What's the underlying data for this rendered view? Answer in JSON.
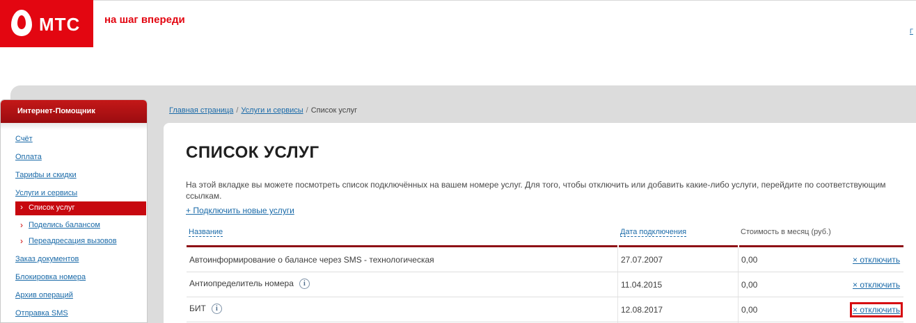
{
  "brand": {
    "logo_text": "МТС",
    "slogan": "на шаг впереди",
    "corner_link": "Г",
    "accent": "#e30611"
  },
  "sidebar": {
    "title": "Интернет-Помощник",
    "items": [
      {
        "label": "Счёт"
      },
      {
        "label": "Оплата"
      },
      {
        "label": "Тарифы и скидки"
      },
      {
        "label": "Услуги и сервисы"
      },
      {
        "label": "Список услуг",
        "active": true
      },
      {
        "label": "Поделись балансом"
      },
      {
        "label": "Переадресация вызовов"
      },
      {
        "label": "Заказ документов"
      },
      {
        "label": "Блокировка номера"
      },
      {
        "label": "Архив операций"
      },
      {
        "label": "Отправка SMS"
      }
    ]
  },
  "breadcrumb": [
    "Главная страница",
    "Услуги и сервисы",
    "Список услуг"
  ],
  "breadcrumb_sep": "/",
  "page": {
    "title": "СПИСОК УСЛУГ",
    "description": "На этой вкладке вы можете посмотреть список подключённых на вашем номере услуг. Для того, чтобы отключить или добавить какие-либо услуги, перейдите по соответствующим ссылкам.",
    "add_link": "+ Подключить новые услуги"
  },
  "table": {
    "headers": {
      "name": "Название",
      "date": "Дата подключения",
      "cost": "Стоимость в месяц (руб.)"
    },
    "disable_label": "× отключить",
    "info_symbol": "i",
    "rows": [
      {
        "name": "Автоинформирование о балансе через SMS - технологическая",
        "date": "27.07.2007",
        "cost": "0,00",
        "info": false
      },
      {
        "name": "Антиопределитель номера",
        "date": "11.04.2015",
        "cost": "0,00",
        "info": true
      },
      {
        "name": "БИТ",
        "date": "12.08.2017",
        "cost": "0,00",
        "info": true,
        "highlighted": true
      }
    ]
  }
}
